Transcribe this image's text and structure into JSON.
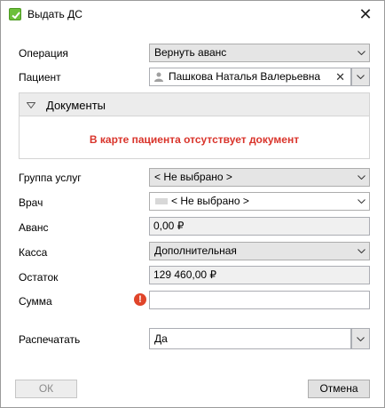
{
  "window": {
    "title": "Выдать ДС",
    "close_glyph": "✕"
  },
  "form": {
    "operation": {
      "label": "Операция",
      "value": "Вернуть аванс"
    },
    "patient": {
      "label": "Пациент",
      "value": "Пашкова Наталья Валерьевна",
      "clear_glyph": "✕"
    },
    "documents": {
      "title": "Документы",
      "warning": "В карте пациента отсутствует документ",
      "warning_color": "#d9342b"
    },
    "service_group": {
      "label": "Группа услуг",
      "value": "< Не выбрано >"
    },
    "doctor": {
      "label": "Врач",
      "value": "< Не выбрано >"
    },
    "advance": {
      "label": "Аванс",
      "value": "0,00 ₽"
    },
    "cash_desk": {
      "label": "Касса",
      "value": "Дополнительная"
    },
    "balance": {
      "label": "Остаток",
      "value": "129 460,00 ₽"
    },
    "amount": {
      "label": "Сумма",
      "value": "",
      "error_glyph": "!"
    },
    "print": {
      "label": "Распечатать",
      "value": "Да"
    }
  },
  "buttons": {
    "ok": "ОК",
    "cancel": "Отмена"
  },
  "icons": {
    "app": "checkbox-icon",
    "person": "person-icon",
    "error": "error-icon"
  }
}
